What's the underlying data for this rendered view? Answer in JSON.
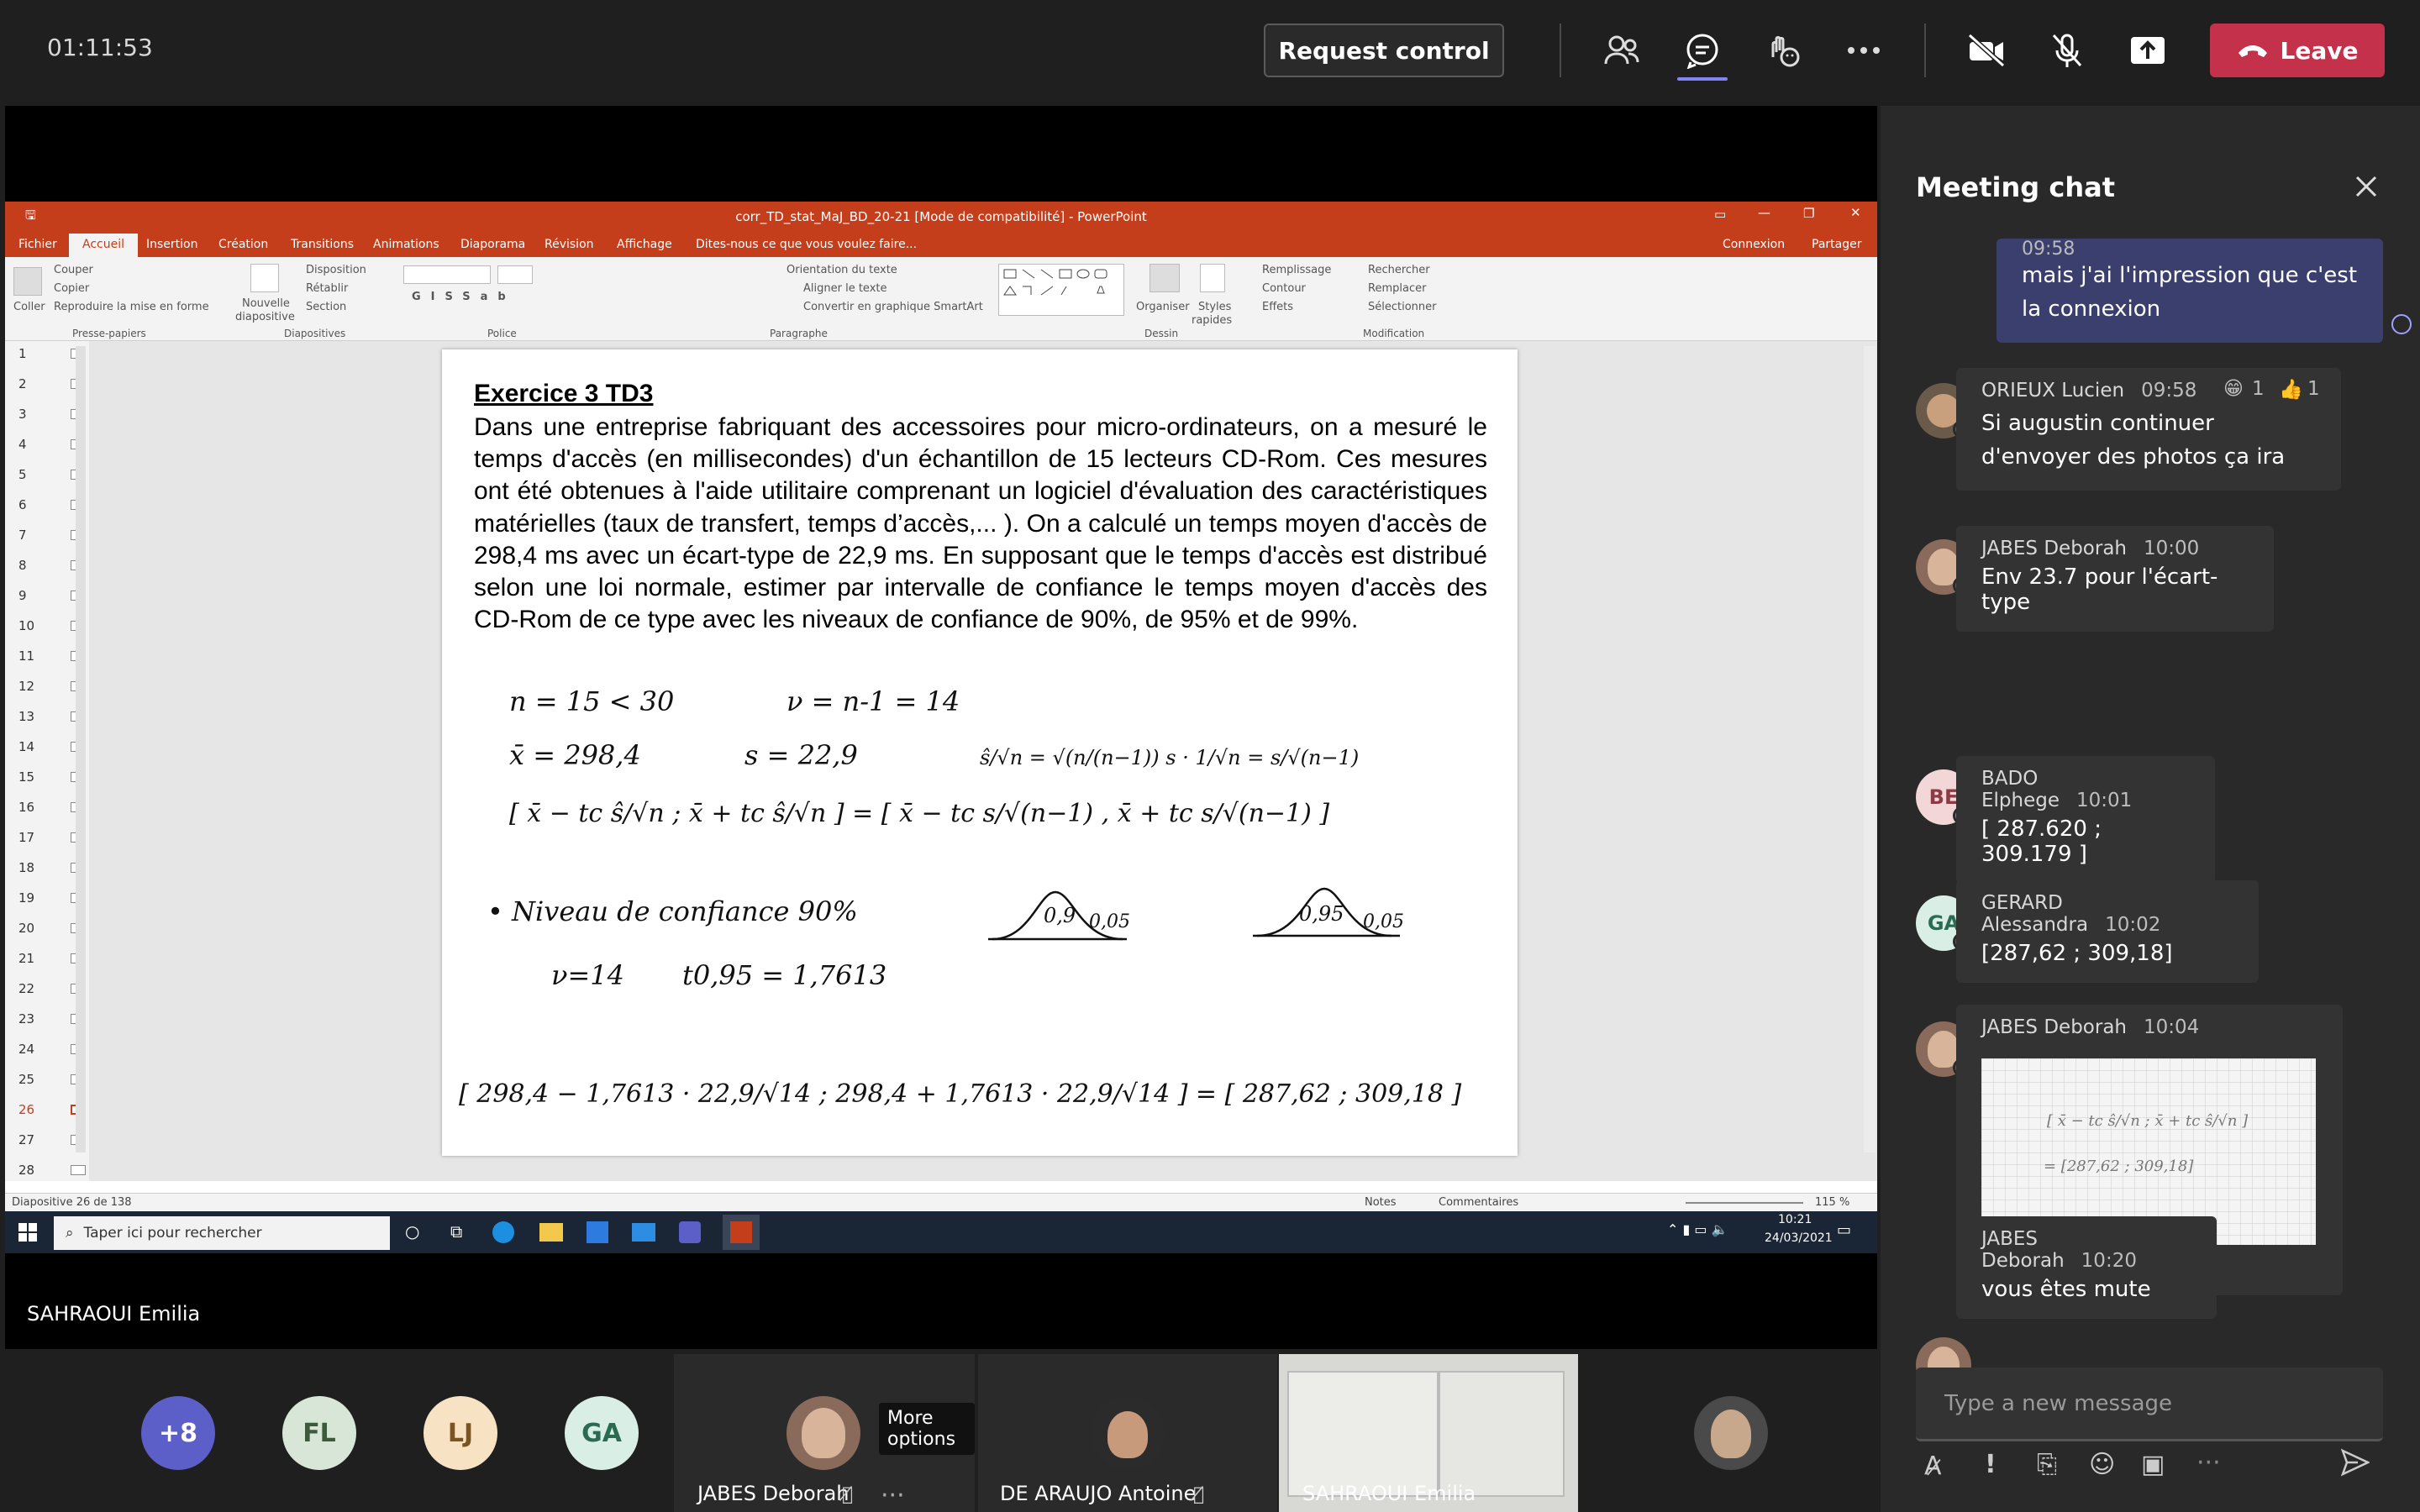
{
  "topbar": {
    "timer": "01:11:53",
    "request_control": "Request control",
    "leave": "Leave"
  },
  "powerpoint": {
    "window_title": "corr_TD_stat_MaJ_BD_20-21 [Mode de compatibilité] - PowerPoint",
    "tabs": [
      "Fichier",
      "Accueil",
      "Insertion",
      "Création",
      "Transitions",
      "Animations",
      "Diaporama",
      "Révision",
      "Affichage"
    ],
    "tell_me": "Dites-nous ce que vous voulez faire...",
    "connexion": "Connexion",
    "partager": "Partager",
    "ribbon": {
      "couper": "Couper",
      "copier": "Copier",
      "reproduire": "Reproduire la mise en forme",
      "coller": "Coller",
      "nouvelle": "Nouvelle",
      "diapositive": "diapositive",
      "disposition": "Disposition",
      "retablir": "Rétablir",
      "section": "Section",
      "orientation": "Orientation du texte",
      "aligner": "Aligner le texte",
      "convertir": "Convertir en graphique SmartArt",
      "organiser": "Organiser",
      "styles": "Styles",
      "rapides": "rapides",
      "remplissage": "Remplissage",
      "contour": "Contour",
      "effets": "Effets",
      "rechercher": "Rechercher",
      "remplacer": "Remplacer",
      "selectionner": "Sélectionner",
      "groups": [
        "Presse-papiers",
        "Diapositives",
        "Police",
        "Paragraphe",
        "Dessin",
        "Modification"
      ]
    },
    "thumbnails": [
      "1",
      "2",
      "3",
      "4",
      "5",
      "6",
      "7",
      "8",
      "9",
      "10",
      "11",
      "12",
      "13",
      "14",
      "15",
      "16",
      "17",
      "18",
      "19",
      "20",
      "21",
      "22",
      "23",
      "24",
      "25",
      "26",
      "27",
      "28"
    ],
    "slide": {
      "heading": "Exercice  3  TD3",
      "paragraph": "Dans une entreprise fabriquant des accessoires pour micro-ordinateurs, on a mesuré le temps d'accès (en millisecondes) d'un échantillon de 15 lecteurs CD-Rom. Ces mesures ont été obtenues à l'aide utilitaire comprenant un logiciel d'évaluation des caractéristiques matérielles (taux de transfert, temps d’accès,... ). On a calculé un temps moyen d'accès de 298,4 ms avec un écart-type de 22,9 ms. En supposant que le temps d'accès est distribué selon une loi normale, estimer par intervalle de confiance le temps moyen d'accès des CD-Rom de ce type avec les niveaux de confiance de 90%, de 95% et de 99%.",
      "handwriting": {
        "l1a": "n = 15 < 30",
        "l1b": "ν = n-1 = 14",
        "l2a": "x̄ = 298,4",
        "l2b": "s = 22,9",
        "l3": "[ x̄ − tc ŝ/√n ; x̄ + tc ŝ/√n ] = [ x̄ − tc s/√(n−1) , x̄ + tc s/√(n−1) ]",
        "l4": "• Niveau de confiance 90%",
        "curve1": "0,9",
        "curve1b": "0,05",
        "curve2": "0,95",
        "curve2b": "0,05",
        "l5a": "ν=14",
        "l5b": "t0,95 = 1,7613",
        "l6": "[ 298,4 − 1,7613 · 22,9/√14 ; 298,4 + 1,7613 · 22,9/√14 ] = [ 287,62 ; 309,18 ]"
      }
    },
    "status": {
      "slide_count": "Diapositive 26 de 138",
      "notes": "Notes",
      "comments": "Commentaires",
      "zoom": "115 %"
    }
  },
  "taskbar": {
    "search": "Taper ici pour rechercher",
    "time": "10:21",
    "date": "24/03/2021"
  },
  "presenter_name": "SAHRAOUI Emilia",
  "chat": {
    "title": "Meeting chat",
    "self_time": "09:58",
    "self_text": "mais j'ai l'impression que c'est la connexion",
    "messages": [
      {
        "author": "ORIEUX Lucien",
        "time": "09:58",
        "text": "Si augustin continuer d'envoyer des photos ça ira",
        "r1": "1",
        "r2": "1"
      },
      {
        "author": "JABES Deborah",
        "time": "10:00",
        "text": "Env 23.7 pour l'écart-type"
      },
      {
        "author": "BADO Elphege",
        "time": "10:01",
        "text": "[ 287.620 ; 309.179 ]",
        "initials": "BE"
      },
      {
        "author": "GERARD Alessandra",
        "time": "10:02",
        "text": "[287,62 ; 309,18]",
        "initials": "GA"
      },
      {
        "author": "JABES Deborah",
        "time": "10:04"
      },
      {
        "author": "JABES Deborah",
        "time": "10:20",
        "text": "vous êtes mute"
      }
    ],
    "image_note": "= [287,62 ; 309,18]",
    "compose_placeholder": "Type a new message"
  },
  "participants": {
    "overflow": "+8",
    "fl": "FL",
    "lj": "LJ",
    "ga": "GA",
    "tile1": "JABES Deborah",
    "tile1_tooltip": "More options",
    "tile2": "DE ARAUJO Antoine",
    "tile3": "SAHRAOUI Emilia"
  },
  "colors": {
    "accent": "#6264a7",
    "leave": "#c4314b",
    "powerpoint": "#c43e1c",
    "self_bubble": "#3b3f6e"
  }
}
